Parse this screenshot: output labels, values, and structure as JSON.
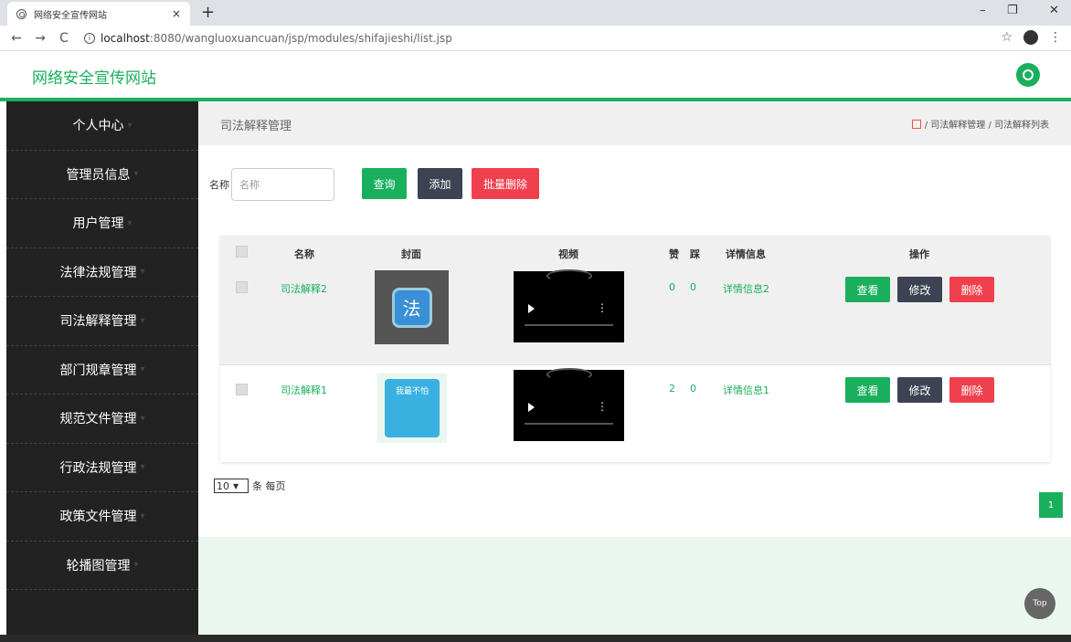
{
  "browser": {
    "tab_title": "网络安全宣传网站",
    "tab_close": "×",
    "new_tab": "+",
    "url_host": "localhost",
    "url_path": ":8080/wangluoxuancuan/jsp/modules/shifajieshi/list.jsp"
  },
  "header": {
    "brand": "网络安全宣传网站"
  },
  "sidebar": {
    "items": [
      {
        "label": "个人中心"
      },
      {
        "label": "管理员信息"
      },
      {
        "label": "用户管理"
      },
      {
        "label": "法律法规管理"
      },
      {
        "label": "司法解释管理"
      },
      {
        "label": "部门规章管理"
      },
      {
        "label": "规范文件管理"
      },
      {
        "label": "行政法规管理"
      },
      {
        "label": "政策文件管理"
      },
      {
        "label": "轮播图管理"
      }
    ]
  },
  "page": {
    "title": "司法解释管理",
    "breadcrumb": "/ 司法解释管理 / 司法解释列表"
  },
  "search": {
    "label": "名称",
    "placeholder": "名称",
    "query_label": "查询",
    "add_label": "添加",
    "batch_delete_label": "批量删除"
  },
  "table": {
    "headers": {
      "name": "名称",
      "cover": "封面",
      "video": "视频",
      "like": "赞",
      "dislike": "踩",
      "detail": "详情信息",
      "ops": "操作"
    },
    "rows": [
      {
        "name": "司法解释2",
        "like": "0",
        "dislike": "0",
        "detail": "详情信息2",
        "cover_text": "法"
      },
      {
        "name": "司法解释1",
        "like": "2",
        "dislike": "0",
        "detail": "详情信息1",
        "cover_text": "我最不怕"
      }
    ],
    "actions": {
      "view": "查看",
      "edit": "修改",
      "delete": "删除"
    }
  },
  "pagination": {
    "page_size": "10",
    "per_page_text": "条 每页",
    "current_page": "1"
  },
  "top_button": "Top"
}
